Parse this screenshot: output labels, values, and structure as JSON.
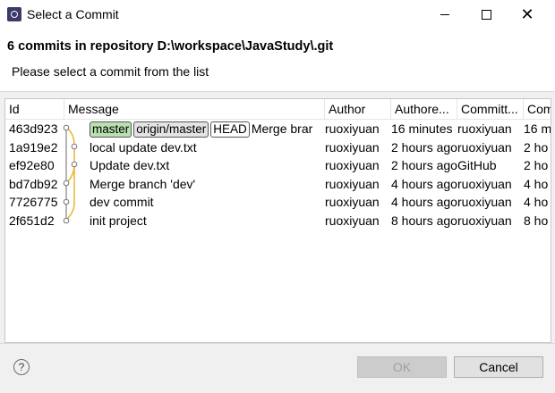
{
  "window": {
    "title": "Select a Commit"
  },
  "header": {
    "title": "6 commits in repository D:\\workspace\\JavaStudy\\.git",
    "subtitle": "Please select a commit from the list"
  },
  "table": {
    "columns": [
      "Id",
      "Message",
      "Author",
      "Authore...",
      "Committ...",
      "Com"
    ],
    "rows": [
      {
        "id": "463d923",
        "refs": [
          "master",
          "origin/master",
          "HEAD"
        ],
        "message": "Merge brar",
        "author": "ruoxiyuan",
        "authored": "16 minutes",
        "committer": "ruoxiyuan",
        "committed": "16 m"
      },
      {
        "id": "1a919e2",
        "refs": [],
        "message": "local update dev.txt",
        "author": "ruoxiyuan",
        "authored": "2 hours ago",
        "committer": "ruoxiyuan",
        "committed": "2 ho"
      },
      {
        "id": "ef92e80",
        "refs": [],
        "message": "Update dev.txt",
        "author": "ruoxiyuan",
        "authored": "2 hours ago",
        "committer": "GitHub",
        "committed": "2 ho"
      },
      {
        "id": "bd7db92",
        "refs": [],
        "message": "Merge branch 'dev'",
        "author": "ruoxiyuan",
        "authored": "4 hours ago",
        "committer": "ruoxiyuan",
        "committed": "4 ho"
      },
      {
        "id": "7726775",
        "refs": [],
        "message": "dev commit",
        "author": "ruoxiyuan",
        "authored": "4 hours ago",
        "committer": "ruoxiyuan",
        "committed": "4 ho"
      },
      {
        "id": "2f651d2",
        "refs": [],
        "message": "init project",
        "author": "ruoxiyuan",
        "authored": "8 hours ago",
        "committer": "ruoxiyuan",
        "committed": "8 ho"
      }
    ]
  },
  "buttons": {
    "help": "?",
    "ok": "OK",
    "cancel": "Cancel"
  },
  "icons": {
    "window": "eclipse-icon",
    "help": "help-icon"
  },
  "colors": {
    "graph_line_yellow": "#e8b52e",
    "graph_line_gray": "#9a9a9a",
    "ref_local": "#b9e0b0"
  }
}
